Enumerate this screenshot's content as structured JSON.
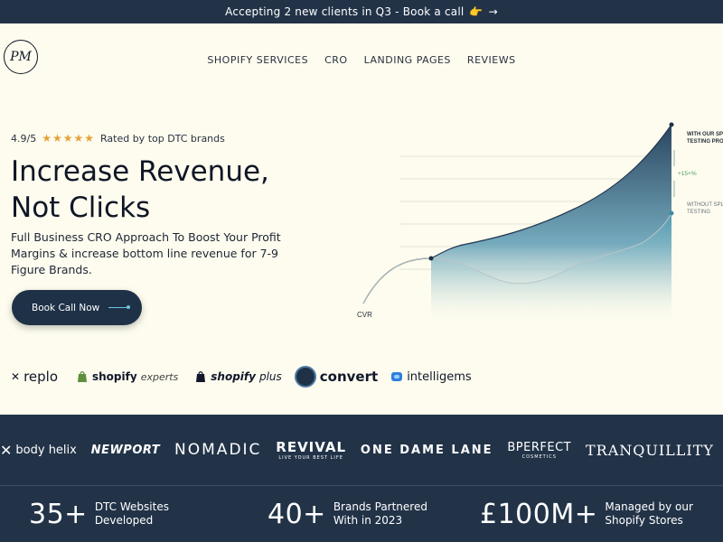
{
  "announcement": {
    "text": "Accepting 2 new clients in Q3 - Book a call",
    "emoji": "👉",
    "arrow": "→"
  },
  "logo": {
    "text": "PM"
  },
  "nav": {
    "items": [
      "SHOPIFY SERVICES",
      "CRO",
      "LANDING PAGES",
      "REVIEWS"
    ]
  },
  "hero": {
    "rating_score": "4.9/5",
    "stars": "★★★★★",
    "rating_text": "Rated by top DTC brands",
    "headline_line1": "Increase Revenue,",
    "headline_line2": "Not Clicks",
    "subtext": "Full Business CRO Approach To Boost Your Profit Margins & increase bottom line revenue for 7-9 Figure Brands.",
    "cta_label": "Book Call Now"
  },
  "chart_data": {
    "type": "area",
    "title": "",
    "xlabel": "",
    "ylabel": "CVR",
    "annotations": [
      "WITH OUR SPLIT TESTING PROCESS",
      "+15+%",
      "WITHOUT SPLIT TESTING"
    ],
    "series": [
      {
        "name": "WITH OUR SPLIT TESTING PROCESS",
        "values": [
          0,
          30,
          40,
          45,
          55,
          70,
          95,
          125,
          160,
          210
        ]
      },
      {
        "name": "WITHOUT SPLIT TESTING",
        "values": [
          0,
          30,
          32,
          25,
          20,
          22,
          30,
          38,
          48,
          100
        ]
      }
    ]
  },
  "partners": {
    "replo": "replo",
    "shopify_experts": "shopify",
    "shopify_experts_suffix": "experts",
    "shopify_plus": "shopify",
    "shopify_plus_suffix": "plus",
    "convert": "convert",
    "intelligems": "intelligems"
  },
  "brands": {
    "body_helix": "body helix",
    "newport": "NEWPORT",
    "nomadic": "NOMADIC",
    "revival": "REVIVAL",
    "revival_tag": "LIVE YOUR BEST LIFE",
    "one_dame_lane": "ONE DAME LANE",
    "bperfect": "BPERFECT",
    "bperfect_tag": "COSMETICS",
    "tranquillity": "TRANQUILLITY"
  },
  "stats": [
    {
      "number": "35+",
      "label": "DTC Websites Developed"
    },
    {
      "number": "40+",
      "label": "Brands Partnered With in 2023"
    },
    {
      "number": "£100M+",
      "label": "Managed by our Shopify Stores"
    }
  ],
  "colors": {
    "navy": "#223348",
    "cream": "#fdfcee",
    "star": "#e8a23a",
    "accent": "#6ec3e0"
  }
}
